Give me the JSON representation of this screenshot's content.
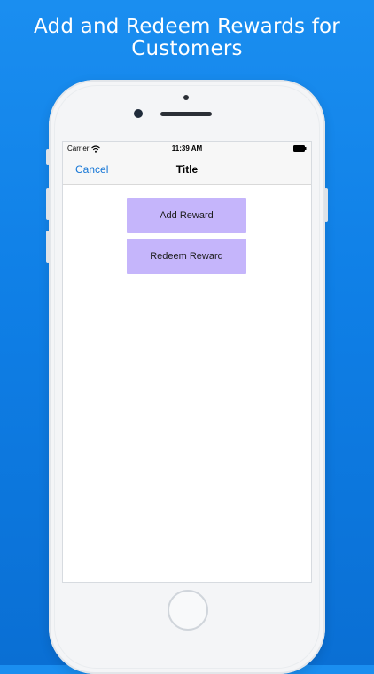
{
  "headline": {
    "line1": "Add and Redeem Rewards for",
    "line2": "Customers"
  },
  "status_bar": {
    "carrier": "Carrier",
    "time": "11:39 AM"
  },
  "navbar": {
    "cancel_label": "Cancel",
    "title": "Title"
  },
  "actions": {
    "add_reward_label": "Add Reward",
    "redeem_reward_label": "Redeem Reward"
  },
  "colors": {
    "background": "#1a8ef0",
    "button_fill": "#c5b5fb",
    "link": "#1576d6"
  }
}
